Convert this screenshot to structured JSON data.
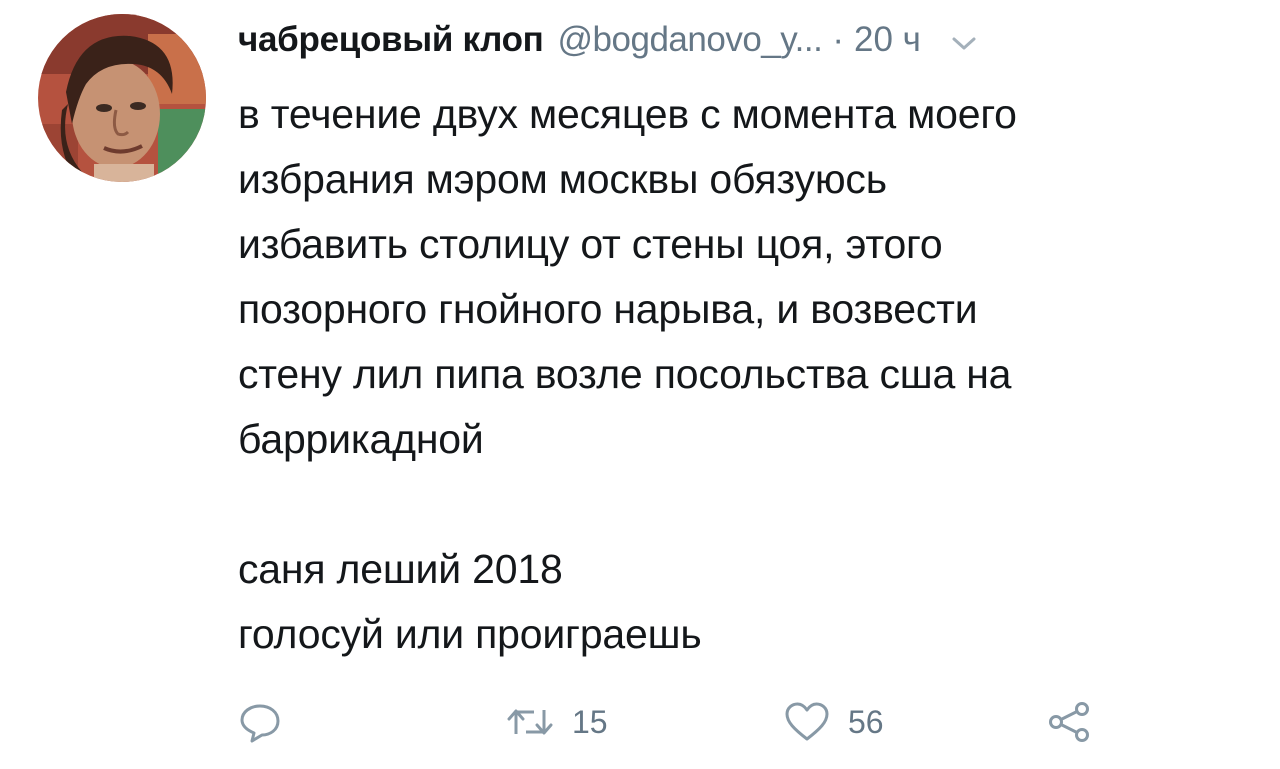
{
  "tweet": {
    "display_name": "чабрецовый клоп",
    "handle": "@bogdanovo_y...",
    "separator": "·",
    "time": "20 ч",
    "text": "в течение двух месяцев с момента моего\nизбрания мэром москвы обязуюсь\nизбавить столицу от стены цоя, этого\nпозорного гнойного нарыва, и возвести\nстену лил пипа возле посольства сша на\nбаррикадной\n\nсаня леший 2018\nголосуй или проиграешь"
  },
  "actions": {
    "reply_icon": "speech-bubble-icon",
    "retweet_icon": "retweet-arrows-icon",
    "retweet_count": "15",
    "like_icon": "heart-icon",
    "like_count": "56",
    "share_icon": "share-nodes-icon"
  },
  "colors": {
    "text_primary": "#14171a",
    "text_secondary": "#657786",
    "background": "#ffffff"
  }
}
